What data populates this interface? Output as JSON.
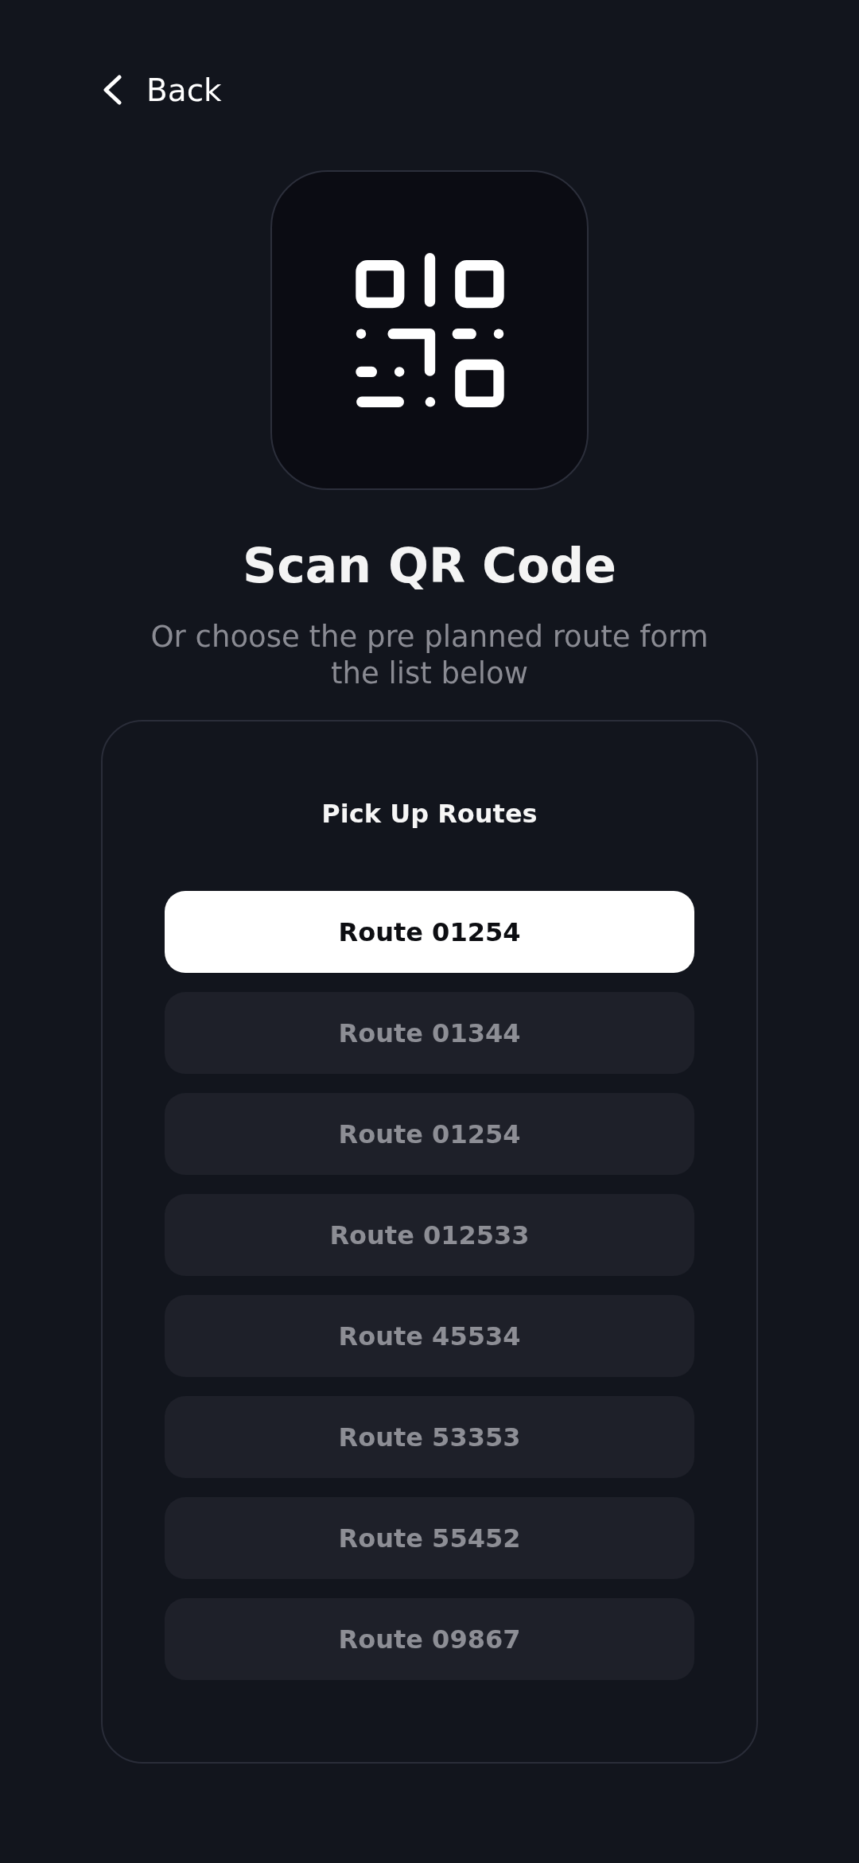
{
  "back_button": {
    "label": "Back"
  },
  "title": "Scan QR Code",
  "subtitle": "Or choose the pre planned route form the list below",
  "routes_card": {
    "title": "Pick Up Routes",
    "routes": [
      {
        "label": "Route 01254",
        "selected": true
      },
      {
        "label": "Route 01344",
        "selected": false
      },
      {
        "label": "Route 01254",
        "selected": false
      },
      {
        "label": "Route 012533",
        "selected": false
      },
      {
        "label": "Route 45534",
        "selected": false
      },
      {
        "label": "Route 53353",
        "selected": false
      },
      {
        "label": "Route 55452",
        "selected": false
      },
      {
        "label": "Route 09867",
        "selected": false
      }
    ]
  }
}
